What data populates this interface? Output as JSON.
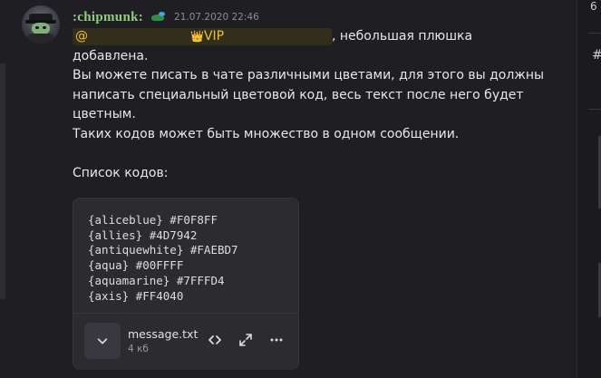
{
  "message": {
    "username": ":chipmunk:",
    "timestamp": "21.07.2020 22:46",
    "mention_prefix": "@",
    "mention_vip": "VIP",
    "line1_suffix": ", небольшая плюшка",
    "line2": "добавлена.",
    "line3": "Вы можете писать в чате различными цветами, для этого вы должны",
    "line4": "написать специальный цветовой код, весь текст после него будет",
    "line5": "цветным.",
    "line6": "Таких кодов может быть множество в одном сообщении.",
    "line7": "Список кодов:"
  },
  "attachment": {
    "code_lines": [
      "{aliceblue} #F0F8FF",
      "{allies} #4D7942",
      "{antiquewhite} #FAEBD7",
      "{aqua} #00FFFF",
      "{aquamarine} #7FFFD4",
      "{axis} #FF4040"
    ],
    "file_name": "message.txt",
    "file_size": "4 кб",
    "icons": [
      "chevron-down-icon",
      "code-icon",
      "expand-icon",
      "more-icon"
    ]
  },
  "sidebar": {
    "top_text": "6",
    "channel_prefix": "#"
  },
  "colors": {
    "background": "#1f1f23",
    "username": "#8fce7c",
    "mention_bg": "#332e1c",
    "mention_text": "#f0c22c",
    "card_bg": "#2b2b30"
  }
}
